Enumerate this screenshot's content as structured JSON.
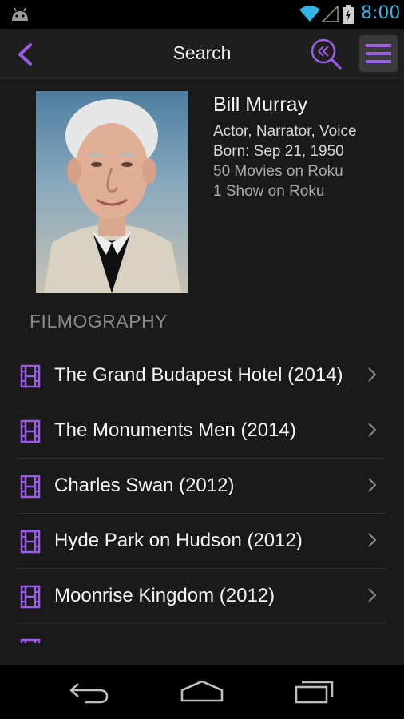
{
  "status_bar": {
    "time": "8:00",
    "icons": [
      "android-icon",
      "wifi-icon",
      "signal-icon",
      "battery-icon"
    ],
    "clock_color": "#33b5e5"
  },
  "action_bar": {
    "title": "Search",
    "back_icon": "chevron-left-icon",
    "search_icon": "search-icon",
    "menu_icon": "hamburger-menu-icon",
    "accent_color": "#9b5de5"
  },
  "person": {
    "name": "Bill Murray",
    "roles": "Actor, Narrator, Voice",
    "born": "Born: Sep 21, 1950",
    "movies": "50 Movies on Roku",
    "shows": "1 Show on Roku"
  },
  "filmography": {
    "heading": "FILMOGRAPHY",
    "items": [
      {
        "title": "The Grand Budapest Hotel (2014)"
      },
      {
        "title": "The Monuments Men (2014)"
      },
      {
        "title": "Charles Swan (2012)"
      },
      {
        "title": "Hyde Park on Hudson (2012)"
      },
      {
        "title": "Moonrise Kingdom (2012)"
      }
    ]
  },
  "nav_bar": {
    "icons": [
      "back-nav-icon",
      "home-nav-icon",
      "recent-apps-icon"
    ]
  }
}
